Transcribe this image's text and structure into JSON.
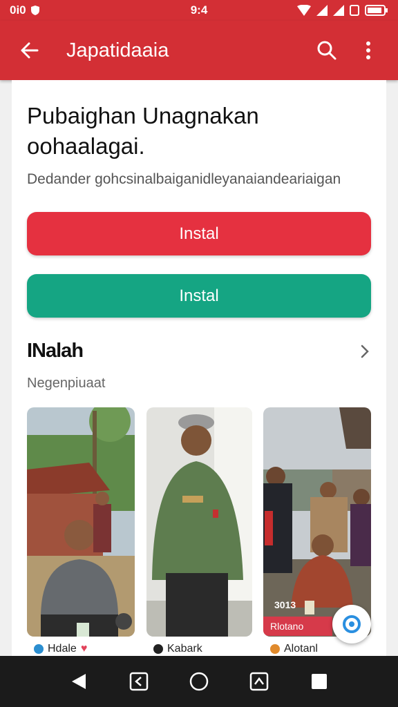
{
  "status_bar": {
    "left_text": "0i0",
    "time": "9:4"
  },
  "app_bar": {
    "title": "Japatidaaia",
    "back_icon": "arrow-back-icon",
    "search_icon": "search-icon",
    "more_icon": "more-vert-icon"
  },
  "main": {
    "heading": "Pubaighan Unagnakan oohaalagai.",
    "subtitle": "Dedander gohcsinalbaiganidleyanaiandeariaigan",
    "install_primary_label": "Instal",
    "install_secondary_label": "Instal",
    "section_title": "INalah",
    "section_subtitle": "Negenpiuaat",
    "thumbnails": [
      {
        "label": "Hdale"
      },
      {
        "label": "Kabark"
      },
      {
        "label": "Alotanl",
        "overlay_text": "Rlotano",
        "overlay_count": "3013"
      }
    ]
  },
  "colors": {
    "primary": "#d32f35",
    "install_red": "#e53140",
    "install_green": "#15a583"
  }
}
